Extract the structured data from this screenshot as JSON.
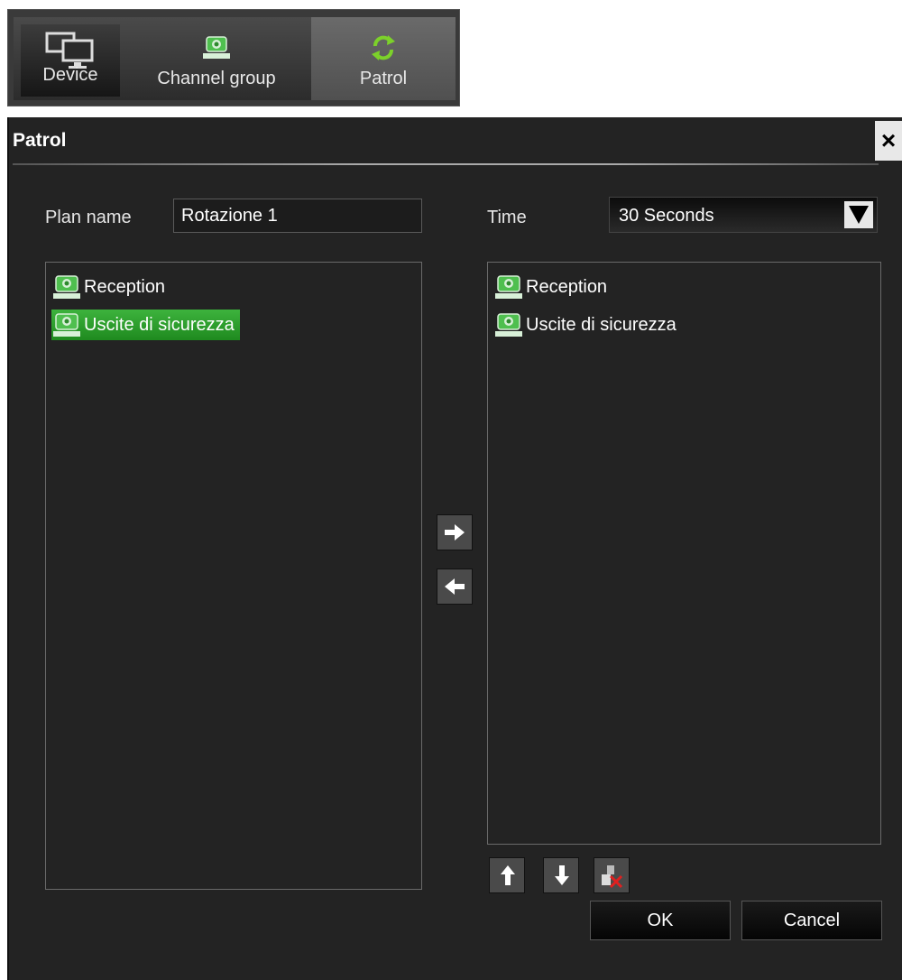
{
  "tabs": [
    {
      "label": "Device",
      "icon": "monitor-icon"
    },
    {
      "label": "Channel group",
      "icon": "channel-group-icon"
    },
    {
      "label": "Patrol",
      "icon": "patrol-refresh-icon"
    }
  ],
  "active_tab": "Patrol",
  "dialog": {
    "title": "Patrol",
    "close_label": "×",
    "plan_name_label": "Plan name",
    "plan_name_value": "Rotazione 1",
    "time_label": "Time",
    "time_value": "30 Seconds",
    "available_channels": [
      {
        "label": "Reception",
        "selected": false
      },
      {
        "label": "Uscite di sicurezza",
        "selected": true
      }
    ],
    "patrol_channels": [
      {
        "label": "Reception"
      },
      {
        "label": "Uscite di sicurezza"
      }
    ],
    "ok_label": "OK",
    "cancel_label": "Cancel"
  },
  "colors": {
    "dialog_bg": "#232323",
    "selection_green": "#2ea02e",
    "tab_active_bg": "#5a5a5a"
  }
}
